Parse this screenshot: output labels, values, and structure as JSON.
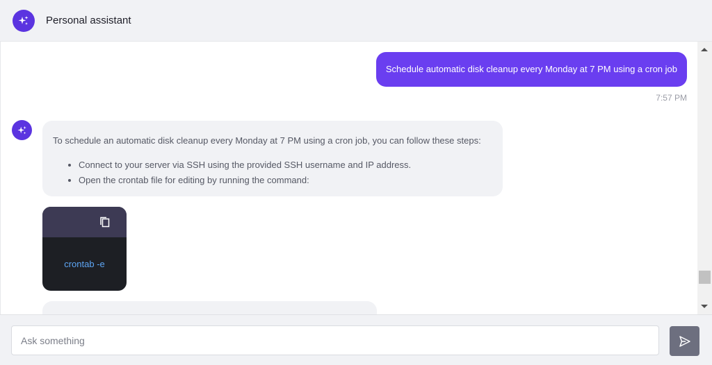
{
  "header": {
    "title": "Personal assistant",
    "avatar_icon": "sparkles-icon"
  },
  "chat": {
    "user_message": {
      "text": "Schedule automatic disk cleanup every Monday at 7 PM using a cron job",
      "time": "7:57 PM"
    },
    "bot_message": {
      "intro": "To schedule an automatic disk cleanup every Monday at 7 PM using a cron job, you can follow these steps:",
      "steps": [
        "Connect to your server via SSH using the provided SSH username and IP address.",
        "Open the crontab file for editing by running the command:"
      ]
    },
    "code_block": {
      "code": "crontab -e",
      "copy_icon": "copy-icon"
    }
  },
  "composer": {
    "placeholder": "Ask something",
    "value": "",
    "send_icon": "send-icon"
  },
  "colors": {
    "accent": "#6a3ef0",
    "avatar": "#5b34e0",
    "code_header": "#3d3a54",
    "code_bg": "#1d1f24",
    "code_text": "#5ea6f5",
    "send_button": "#6d6f7f"
  }
}
